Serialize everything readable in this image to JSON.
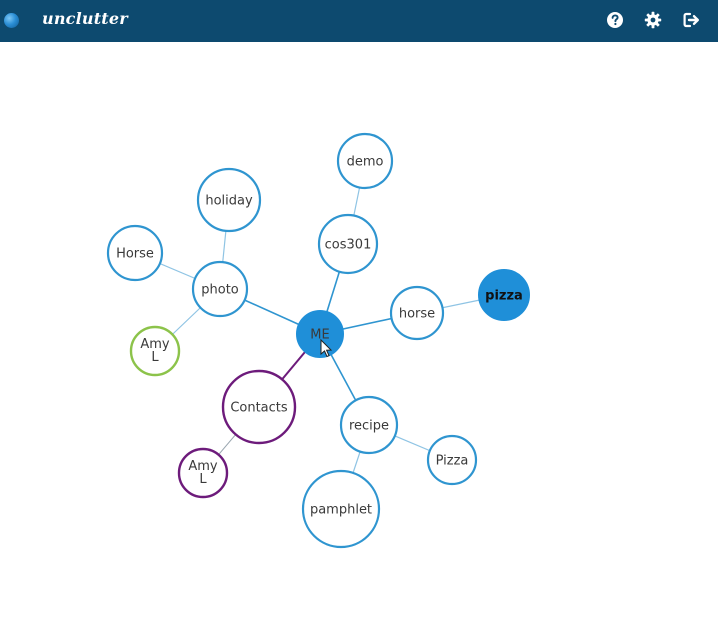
{
  "app": {
    "title": "unclutter"
  },
  "toolbar": {
    "icons": [
      "help-icon",
      "settings-icon",
      "logout-icon"
    ]
  },
  "colors": {
    "navbar": "#0d4a6f",
    "node_border": "#2f95d0",
    "node_fill_active": "#1f8fd8",
    "contacts": "#6d1b7b",
    "friend_green": "#8cc34a"
  },
  "graph": {
    "nodes": [
      {
        "id": "me",
        "label": "ME",
        "style": "filled"
      },
      {
        "id": "cos301",
        "label": "cos301",
        "style": "outline"
      },
      {
        "id": "demo",
        "label": "demo",
        "style": "outline"
      },
      {
        "id": "photo",
        "label": "photo",
        "style": "outline"
      },
      {
        "id": "holiday",
        "label": "holiday",
        "style": "outline"
      },
      {
        "id": "horse-left",
        "label": "Horse",
        "style": "outline"
      },
      {
        "id": "amy-green",
        "label": [
          "Amy",
          "L"
        ],
        "style": "green"
      },
      {
        "id": "horse",
        "label": "horse",
        "style": "outline"
      },
      {
        "id": "pizza",
        "label": "pizza",
        "style": "filled-bold"
      },
      {
        "id": "contacts",
        "label": "Contacts",
        "style": "purple"
      },
      {
        "id": "amy-purple",
        "label": [
          "Amy",
          "L"
        ],
        "style": "purple"
      },
      {
        "id": "recipe",
        "label": "recipe",
        "style": "outline"
      },
      {
        "id": "pizza-small",
        "label": "Pizza",
        "style": "outline"
      },
      {
        "id": "pamphlet",
        "label": "pamphlet",
        "style": "outline"
      }
    ],
    "edges": [
      [
        "me",
        "cos301"
      ],
      [
        "cos301",
        "demo"
      ],
      [
        "me",
        "photo"
      ],
      [
        "photo",
        "holiday"
      ],
      [
        "photo",
        "horse-left"
      ],
      [
        "photo",
        "amy-green"
      ],
      [
        "me",
        "horse"
      ],
      [
        "horse",
        "pizza"
      ],
      [
        "me",
        "contacts"
      ],
      [
        "contacts",
        "amy-purple"
      ],
      [
        "me",
        "recipe"
      ],
      [
        "recipe",
        "pizza-small"
      ],
      [
        "recipe",
        "pamphlet"
      ]
    ]
  }
}
